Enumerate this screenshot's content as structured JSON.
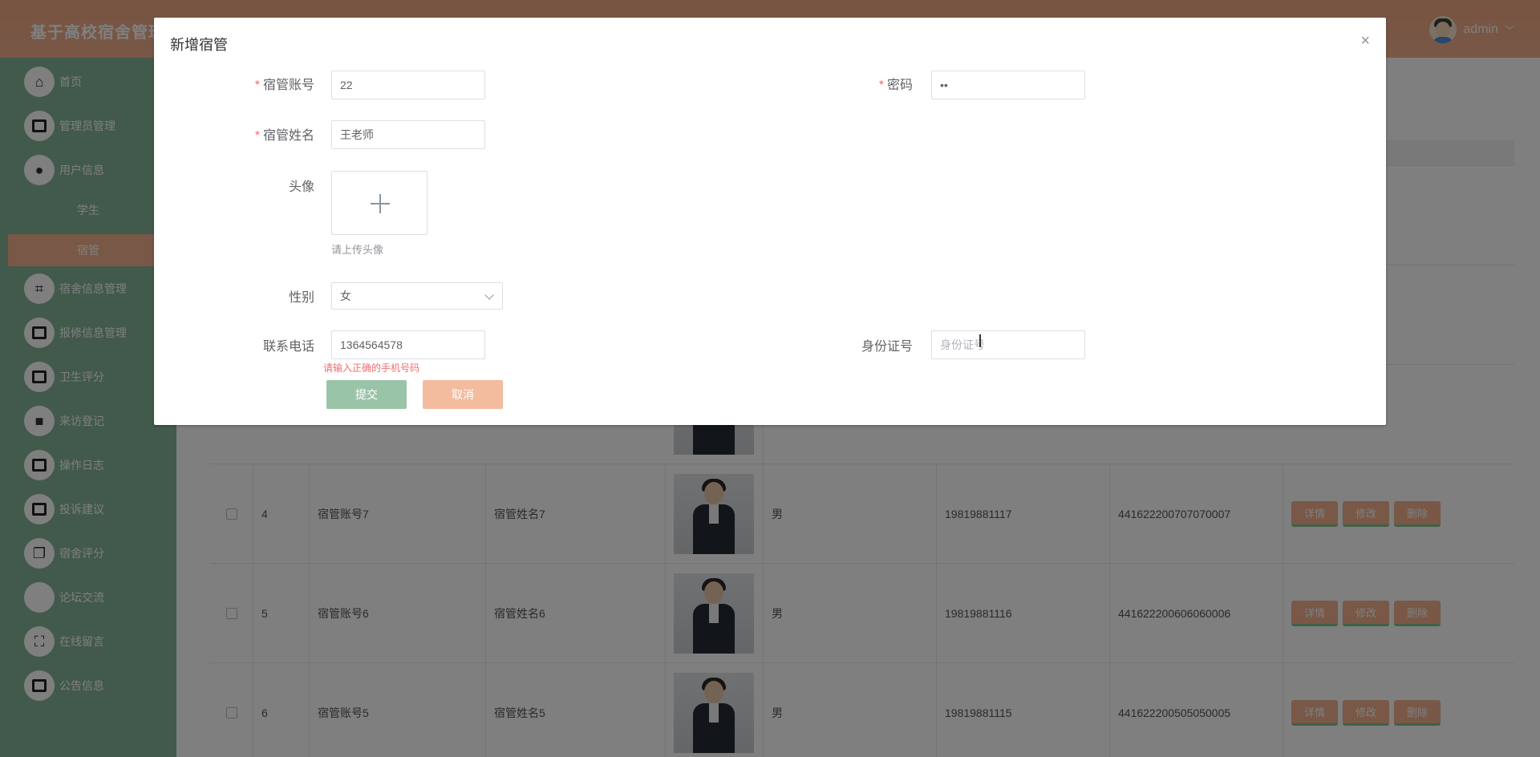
{
  "header": {
    "title": "基于高校宿舍管理",
    "user": "admin"
  },
  "sidebar": {
    "items": [
      {
        "label": "首页"
      },
      {
        "label": "管理员管理"
      },
      {
        "label": "用户信息"
      },
      {
        "label": "学生"
      },
      {
        "label": "宿管"
      },
      {
        "label": "宿舍信息管理"
      },
      {
        "label": "报修信息管理"
      },
      {
        "label": "卫生评分"
      },
      {
        "label": "来访登记"
      },
      {
        "label": "操作日志"
      },
      {
        "label": "投诉建议"
      },
      {
        "label": "宿舍评分"
      },
      {
        "label": "论坛交流"
      },
      {
        "label": "在线留言"
      },
      {
        "label": "公告信息"
      }
    ]
  },
  "table": {
    "rows": [
      {
        "index": "4",
        "account": "宿管账号7",
        "name": "宿管姓名7",
        "gender": "男",
        "phone": "19819881117",
        "id_card": "441622200707070007"
      },
      {
        "index": "5",
        "account": "宿管账号6",
        "name": "宿管姓名6",
        "gender": "男",
        "phone": "19819881116",
        "id_card": "441622200606060006"
      },
      {
        "index": "6",
        "account": "宿管账号5",
        "name": "宿管姓名5",
        "gender": "男",
        "phone": "19819881115",
        "id_card": "441622200505050005"
      }
    ],
    "actions": {
      "detail": "详情",
      "edit": "修改",
      "delete": "删除"
    }
  },
  "modal": {
    "title": "新增宿管",
    "close": "×",
    "fields": {
      "account": {
        "label": "宿管账号",
        "value": "22"
      },
      "password": {
        "label": "密码",
        "value": "••"
      },
      "name": {
        "label": "宿管姓名",
        "value": "王老师"
      },
      "avatar": {
        "label": "头像",
        "hint": "请上传头像"
      },
      "gender": {
        "label": "性别",
        "value": "女"
      },
      "phone": {
        "label": "联系电话",
        "value": "1364564578",
        "error": "请输入正确的手机号码"
      },
      "id_card": {
        "label": "身份证号",
        "placeholder": "身份证号"
      }
    },
    "submit": "提交",
    "cancel": "取消"
  }
}
